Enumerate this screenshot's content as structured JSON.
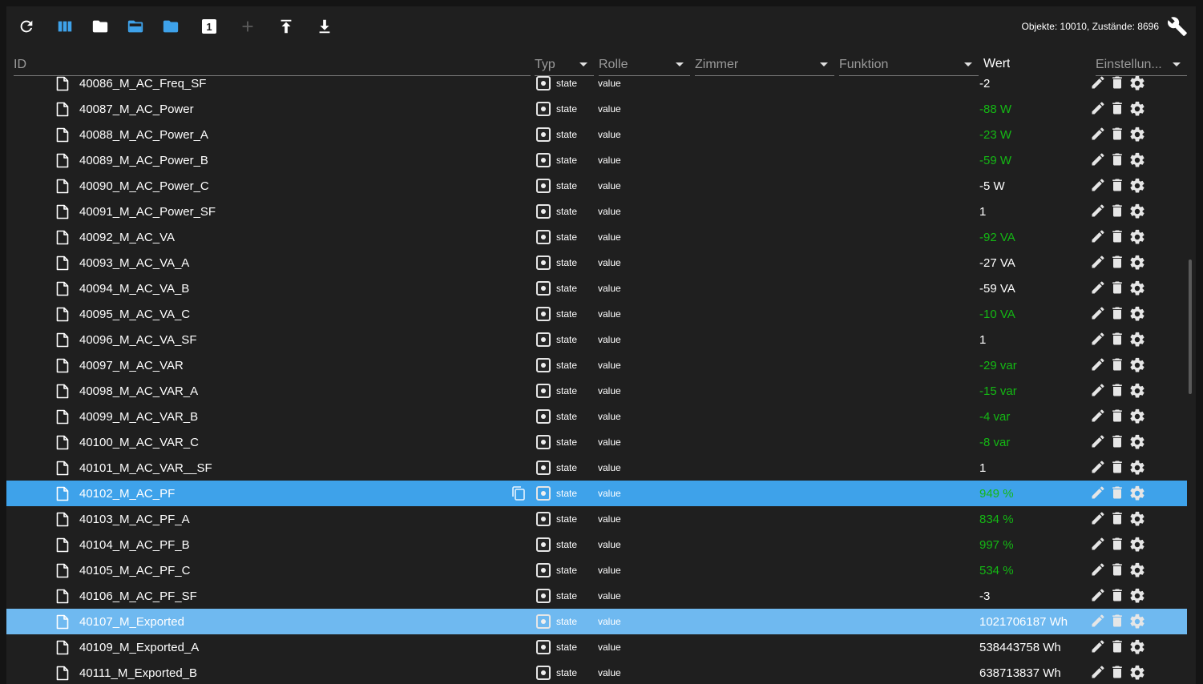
{
  "toolbar": {
    "buttons": [
      {
        "name": "refresh-button",
        "icon": "refresh-icon"
      },
      {
        "name": "columns-button",
        "icon": "columns-icon"
      },
      {
        "name": "folder-button",
        "icon": "folder-icon"
      },
      {
        "name": "folder-open-button",
        "icon": "folder-open-icon"
      },
      {
        "name": "folder-blue-button",
        "icon": "folder-icon"
      },
      {
        "name": "number-button",
        "icon": "number-one-icon",
        "label": "1"
      },
      {
        "name": "add-button",
        "icon": "plus-icon"
      },
      {
        "name": "upload-button",
        "icon": "upload-icon"
      },
      {
        "name": "download-button",
        "icon": "download-icon"
      }
    ],
    "counts": "Objekte: 10010, Zustände: 8696"
  },
  "header": {
    "id": "ID",
    "type": "Typ",
    "role": "Rolle",
    "room": "Zimmer",
    "function": "Funktion",
    "value": "Wert",
    "settings": "Einstellun..."
  },
  "colors": {
    "green": "#14b814",
    "selected": "#3ea2ea",
    "selected_light": "#6fb9f0",
    "accent": "#3ea2ea"
  },
  "rows": [
    {
      "id": "40086_M_AC_Freq_SF",
      "type": "state",
      "role": "value",
      "value": "-2",
      "color": "white"
    },
    {
      "id": "40087_M_AC_Power",
      "type": "state",
      "role": "value",
      "value": "-88 W",
      "color": "green"
    },
    {
      "id": "40088_M_AC_Power_A",
      "type": "state",
      "role": "value",
      "value": "-23 W",
      "color": "green"
    },
    {
      "id": "40089_M_AC_Power_B",
      "type": "state",
      "role": "value",
      "value": "-59 W",
      "color": "green"
    },
    {
      "id": "40090_M_AC_Power_C",
      "type": "state",
      "role": "value",
      "value": "-5 W",
      "color": "white"
    },
    {
      "id": "40091_M_AC_Power_SF",
      "type": "state",
      "role": "value",
      "value": "1",
      "color": "white"
    },
    {
      "id": "40092_M_AC_VA",
      "type": "state",
      "role": "value",
      "value": "-92 VA",
      "color": "green"
    },
    {
      "id": "40093_M_AC_VA_A",
      "type": "state",
      "role": "value",
      "value": "-27 VA",
      "color": "white"
    },
    {
      "id": "40094_M_AC_VA_B",
      "type": "state",
      "role": "value",
      "value": "-59 VA",
      "color": "white"
    },
    {
      "id": "40095_M_AC_VA_C",
      "type": "state",
      "role": "value",
      "value": "-10 VA",
      "color": "green"
    },
    {
      "id": "40096_M_AC_VA_SF",
      "type": "state",
      "role": "value",
      "value": "1",
      "color": "white"
    },
    {
      "id": "40097_M_AC_VAR",
      "type": "state",
      "role": "value",
      "value": "-29 var",
      "color": "green"
    },
    {
      "id": "40098_M_AC_VAR_A",
      "type": "state",
      "role": "value",
      "value": "-15 var",
      "color": "green"
    },
    {
      "id": "40099_M_AC_VAR_B",
      "type": "state",
      "role": "value",
      "value": "-4 var",
      "color": "green"
    },
    {
      "id": "40100_M_AC_VAR_C",
      "type": "state",
      "role": "value",
      "value": "-8 var",
      "color": "green"
    },
    {
      "id": "40101_M_AC_VAR__SF",
      "type": "state",
      "role": "value",
      "value": "1",
      "color": "white"
    },
    {
      "id": "40102_M_AC_PF",
      "type": "state",
      "role": "value",
      "value": "949 %",
      "color": "green",
      "selected": "sel",
      "copy": true
    },
    {
      "id": "40103_M_AC_PF_A",
      "type": "state",
      "role": "value",
      "value": "834 %",
      "color": "green"
    },
    {
      "id": "40104_M_AC_PF_B",
      "type": "state",
      "role": "value",
      "value": "997 %",
      "color": "green"
    },
    {
      "id": "40105_M_AC_PF_C",
      "type": "state",
      "role": "value",
      "value": "534 %",
      "color": "green"
    },
    {
      "id": "40106_M_AC_PF_SF",
      "type": "state",
      "role": "value",
      "value": "-3",
      "color": "white"
    },
    {
      "id": "40107_M_Exported",
      "type": "state",
      "role": "value",
      "value": "1021706187 Wh",
      "color": "white",
      "selected": "sel2"
    },
    {
      "id": "40109_M_Exported_A",
      "type": "state",
      "role": "value",
      "value": "538443758 Wh",
      "color": "white"
    },
    {
      "id": "40111_M_Exported_B",
      "type": "state",
      "role": "value",
      "value": "638713837 Wh",
      "color": "white"
    }
  ]
}
